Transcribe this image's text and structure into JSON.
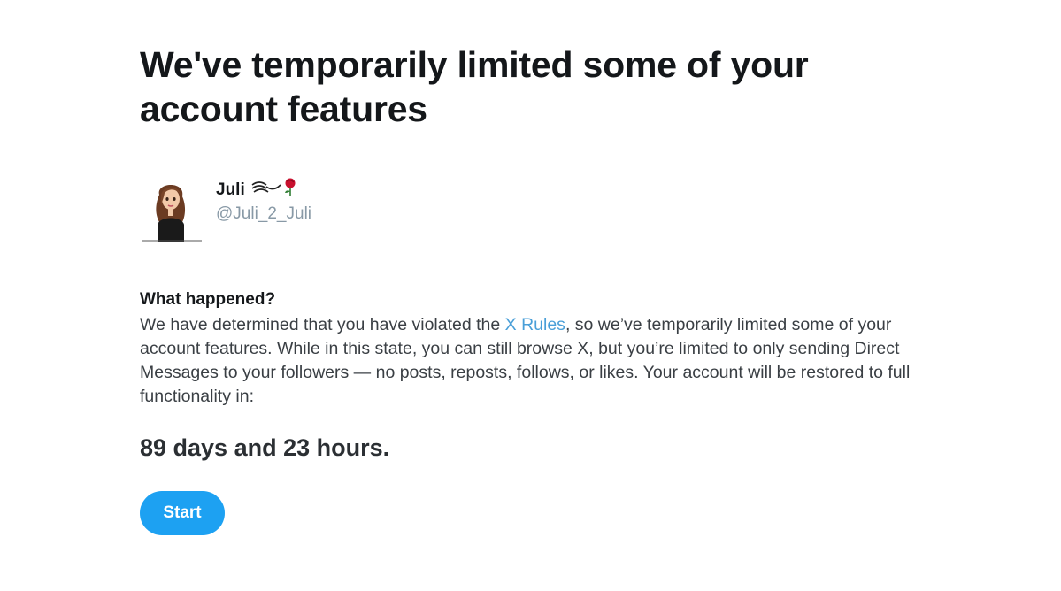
{
  "headline": "We've temporarily limited some of your account features",
  "account": {
    "display_name": "Juli",
    "display_name_emoji": "rose-emoji",
    "handle": "@Juli_2_Juli",
    "avatar": "avatar-image"
  },
  "what_happened": {
    "title": "What happened?",
    "body_before_link": "We have determined that you have violated the ",
    "link_text": "X Rules",
    "body_after_link": ", so we’ve temporarily limited some of your account features. While in this state, you can still browse X, but you’re limited to only sending Direct Messages to your followers — no posts, reposts, follows, or likes. Your account will be restored to full functionality in:"
  },
  "countdown": "89 days and 23 hours.",
  "start_button": {
    "label": "Start"
  },
  "colors": {
    "accent": "#1da1f2",
    "link": "#4a9fd8",
    "handle": "#8899a6"
  }
}
